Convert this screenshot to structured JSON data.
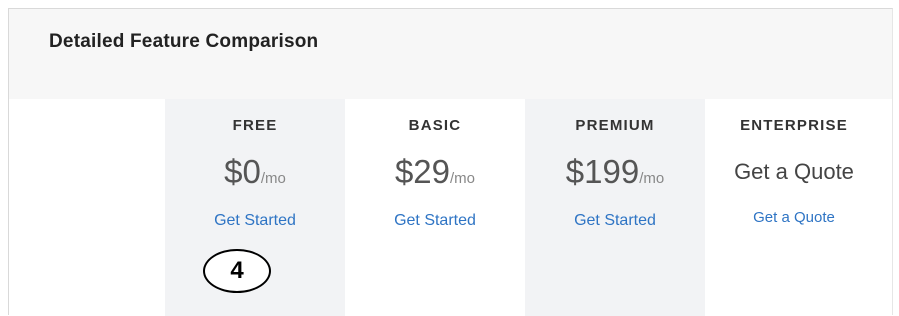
{
  "page": {
    "title": "Detailed Feature Comparison"
  },
  "plans": [
    {
      "name": "FREE",
      "price": "$0",
      "unit": "/mo",
      "cta": "Get Started"
    },
    {
      "name": "BASIC",
      "price": "$29",
      "unit": "/mo",
      "cta": "Get Started"
    },
    {
      "name": "PREMIUM",
      "price": "$199",
      "unit": "/mo",
      "cta": "Get Started"
    },
    {
      "name": "ENTERPRISE",
      "price": "Get a Quote",
      "cta": "Get a Quote"
    }
  ],
  "annotation": {
    "step": "4"
  },
  "colors": {
    "link": "#2e74c4",
    "shaded_column": "#f2f3f5",
    "header_band": "#f7f7f7"
  }
}
